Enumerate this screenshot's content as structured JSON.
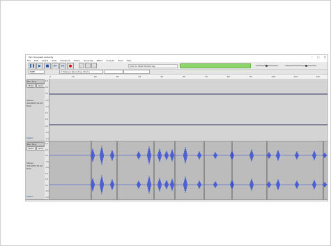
{
  "window": {
    "title": "Pan Tony.aup3 Audacity",
    "controls": [
      "–",
      "▢",
      "✕"
    ]
  },
  "menu": [
    "File",
    "Edit",
    "Select",
    "View",
    "Transport",
    "Tracks",
    "Generate",
    "Effect",
    "Analyze",
    "Tools",
    "Help"
  ],
  "toolbar": {
    "pause_label": "❚❚",
    "play_label": "▶",
    "stop_label": "■",
    "skip_start_label": "⏮",
    "skip_end_label": "⏭",
    "record_label": "●",
    "monitor_text": "Click to Start Monitoring",
    "host_label": "MME",
    "recording_channels": "2 (Stereo) Recording Chann"
  },
  "ruler": {
    "ticks": [
      "0",
      "10",
      "20",
      "30",
      "40",
      "50",
      "60",
      "70",
      "80",
      "90",
      "100",
      "110",
      "120"
    ]
  },
  "tracks": [
    {
      "name": "Pan Tony",
      "mute_label": "Mute",
      "solo_label": "Solo",
      "info": "Stereo, 44100Hz\n32-bit float",
      "select_label": "Select",
      "scale": [
        "1.0",
        "0.5",
        "0.0",
        "-0.5",
        "-1.0",
        "1.0",
        "0.5",
        "0.0",
        "-0.5",
        "-1.0"
      ]
    },
    {
      "name": "Pan Tony",
      "mute_label": "Mute",
      "solo_label": "Solo",
      "info": "Stereo, 44100Hz\n32-bit float",
      "select_label": "Select",
      "scale": [
        "1.0",
        "0.5",
        "0.0",
        "-0.5",
        "-1.0",
        "1.0",
        "0.5",
        "0.0",
        "-0.5",
        "-1.0"
      ]
    }
  ],
  "colors": {
    "waveform": "#3a4fd6",
    "track_bg": "#d4d4d4",
    "selected_bg": "#b9b9b9",
    "meter_green": "#8fd36c"
  }
}
